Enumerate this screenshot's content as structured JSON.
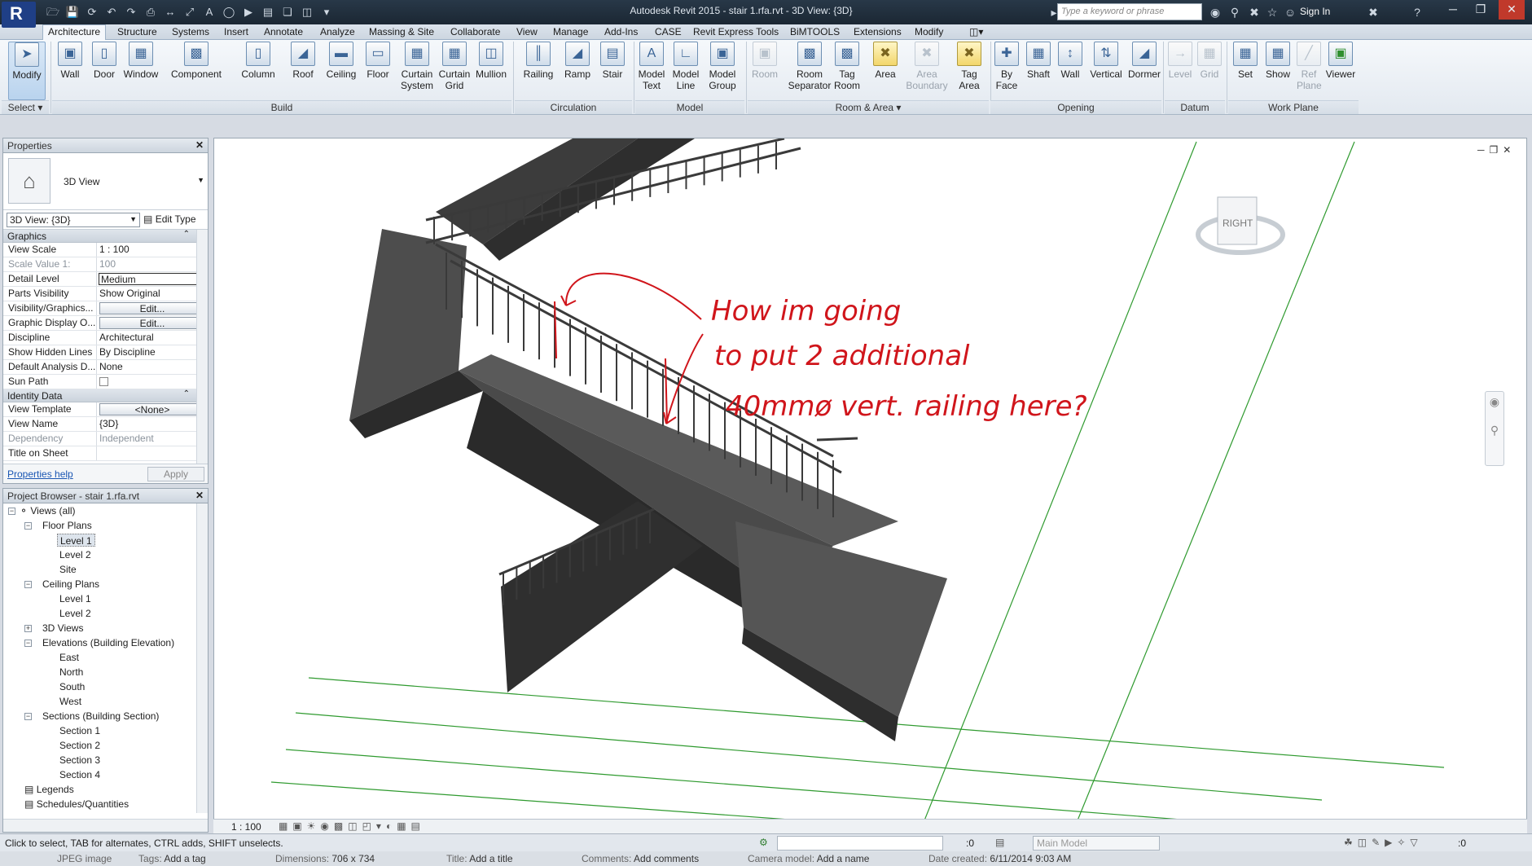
{
  "window": {
    "title": "Autodesk Revit 2015 -    stair 1.rfa.rvt - 3D View: {3D}",
    "search_placeholder": "Type a keyword or phrase",
    "sign_in": "Sign In"
  },
  "tabs": [
    "Architecture",
    "Structure",
    "Systems",
    "Insert",
    "Annotate",
    "Analyze",
    "Massing & Site",
    "Collaborate",
    "View",
    "Manage",
    "Add-Ins",
    "CASE",
    "Revit Express Tools",
    "BiMTOOLS",
    "Extensions",
    "Modify"
  ],
  "ribbon": {
    "modify": "Modify",
    "select_panel": "Select",
    "build": {
      "panel": "Build",
      "buttons": [
        "Wall",
        "Door",
        "Window",
        "Component",
        "Column",
        "Roof",
        "Ceiling",
        "Floor",
        "Curtain System",
        "Curtain Grid",
        "Mullion"
      ]
    },
    "circulation": {
      "panel": "Circulation",
      "buttons": [
        "Railing",
        "Ramp",
        "Stair"
      ]
    },
    "model": {
      "panel": "Model",
      "buttons": [
        "Model Text",
        "Model Line",
        "Model Group"
      ]
    },
    "room_area": {
      "panel": "Room & Area",
      "buttons": [
        "Room",
        "Room Separator",
        "Tag Room",
        "Area",
        "Area Boundary",
        "Tag Area"
      ]
    },
    "opening": {
      "panel": "Opening",
      "buttons": [
        "By Face",
        "Shaft",
        "Wall",
        "Vertical",
        "Dormer"
      ]
    },
    "datum": {
      "panel": "Datum",
      "buttons": [
        "Level",
        "Grid"
      ]
    },
    "work_plane": {
      "panel": "Work Plane",
      "buttons": [
        "Set",
        "Show",
        "Ref Plane",
        "Viewer"
      ]
    }
  },
  "properties": {
    "title": "Properties",
    "type_name": "3D View",
    "instance_selector": "3D View: {3D}",
    "edit_type": "Edit Type",
    "groups": {
      "graphics": "Graphics",
      "identity": "Identity Data"
    },
    "graphics_rows": [
      {
        "k": "View Scale",
        "v": "1 : 100"
      },
      {
        "k": "Scale Value    1:",
        "v": "100"
      },
      {
        "k": "Detail Level",
        "v": "Medium"
      },
      {
        "k": "Parts Visibility",
        "v": "Show Original"
      },
      {
        "k": "Visibility/Graphics...",
        "v": "Edit..."
      },
      {
        "k": "Graphic Display O...",
        "v": "Edit..."
      },
      {
        "k": "Discipline",
        "v": "Architectural"
      },
      {
        "k": "Show Hidden Lines",
        "v": "By Discipline"
      },
      {
        "k": "Default Analysis D...",
        "v": "None"
      },
      {
        "k": "Sun Path",
        "v": ""
      }
    ],
    "identity_rows": [
      {
        "k": "View Template",
        "v": "<None>"
      },
      {
        "k": "View Name",
        "v": "{3D}"
      },
      {
        "k": "Dependency",
        "v": "Independent"
      },
      {
        "k": "Title on Sheet",
        "v": ""
      }
    ],
    "help_link": "Properties help",
    "apply": "Apply"
  },
  "browser": {
    "title": "Project Browser - stair 1.rfa.rvt",
    "items": {
      "views_all": "Views (all)",
      "floor_plans": "Floor Plans",
      "fp_level1": "Level 1",
      "fp_level2": "Level 2",
      "fp_site": "Site",
      "ceiling_plans": "Ceiling Plans",
      "cp_level1": "Level 1",
      "cp_level2": "Level 2",
      "views_3d": "3D Views",
      "elevations": "Elevations (Building Elevation)",
      "el_east": "East",
      "el_north": "North",
      "el_south": "South",
      "el_west": "West",
      "sections": "Sections (Building Section)",
      "sec1": "Section 1",
      "sec2": "Section 2",
      "sec3": "Section 3",
      "sec4": "Section 4",
      "legends": "Legends",
      "schedules": "Schedules/Quantities"
    }
  },
  "viewport": {
    "viewcube_face": "RIGHT",
    "annotation_lines": [
      "How im going",
      "to put 2 additional",
      "40mmø vert. railing here?"
    ]
  },
  "view_bar": {
    "scale": "1 : 100"
  },
  "status": {
    "text": "Click to select, TAB for alternates, CTRL adds, SHIFT unselects.",
    "selection_count": ":0",
    "model": "Main Model",
    "filter_count": ":0"
  },
  "info_strip": {
    "type": "JPEG image",
    "tags_label": "Tags:",
    "tags_value": "Add a tag",
    "dims_label": "Dimensions:",
    "dims_value": "706 x 734",
    "title_label": "Title:",
    "title_value": "Add a title",
    "comments_label": "Comments:",
    "comments_value": "Add comments",
    "camera_label": "Camera model:",
    "camera_value": "Add a name",
    "date_label": "Date created:",
    "date_value": "6/11/2014 9:03 AM"
  },
  "colors": {
    "annotation": "#d0151b",
    "grid_lines": "#2f9a2f",
    "stair": "#4a4a4a"
  }
}
